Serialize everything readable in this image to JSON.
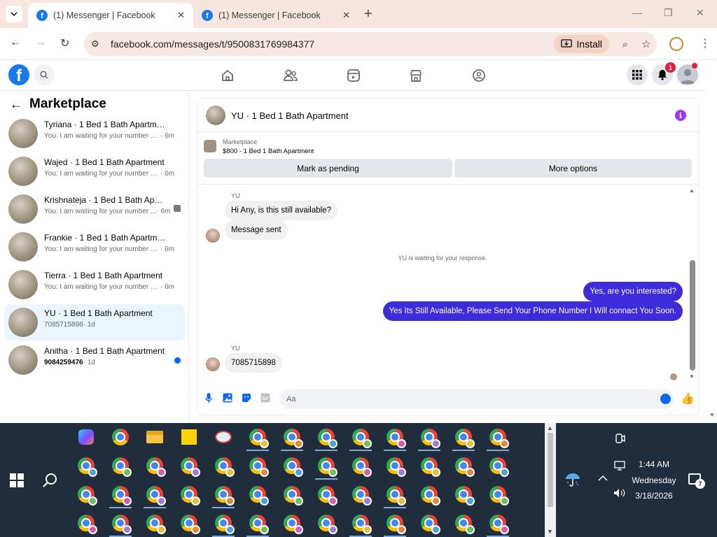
{
  "browser": {
    "tabs": [
      {
        "title": "(1) Messenger | Facebook",
        "active": true
      },
      {
        "title": "(1) Messenger | Facebook",
        "active": false
      }
    ],
    "url": "facebook.com/messages/t/9500831769984377",
    "install_label": "Install"
  },
  "facebook": {
    "notifications_count": "1"
  },
  "sidebar": {
    "title": "Marketplace",
    "conversations": [
      {
        "name": "Tyriana · 1 Bed 1 Bath Apartment",
        "preview": "You: I am waiting for your number se...",
        "time": "· 6m",
        "selected": false,
        "unread": false
      },
      {
        "name": "Wajed · 1 Bed 1 Bath Apartment",
        "preview": "You: I am waiting for your number se...",
        "time": "· 6m",
        "selected": false,
        "unread": false
      },
      {
        "name": "Krishnateja · 1 Bed 1 Bath Apart...",
        "preview": "You: I am waiting for your number ...",
        "time": "· 6m",
        "selected": false,
        "unread": false
      },
      {
        "name": "Frankie · 1 Bed 1 Bath Apartment",
        "preview": "You: I am waiting for your number se...",
        "time": "· 6m",
        "selected": false,
        "unread": false
      },
      {
        "name": "Tierra · 1 Bed 1 Bath Apartment",
        "preview": "You: I am waiting for your number se...",
        "time": "· 6m",
        "selected": false,
        "unread": false
      },
      {
        "name": "YU · 1 Bed 1 Bath Apartment",
        "preview": "7085715898",
        "time": "· 1d",
        "selected": true,
        "unread": false
      },
      {
        "name": "Anitha · 1 Bed 1 Bath Apartment",
        "preview": "9084259476",
        "time": "· 1d",
        "selected": false,
        "unread": true
      }
    ]
  },
  "chat": {
    "title": "YU · 1 Bed 1 Bath Apartment",
    "marketplace_label": "Marketplace",
    "listing": "$800 - 1 Bed 1 Bath Apartment",
    "mark_pending_label": "Mark as pending",
    "more_options_label": "More options",
    "messages": {
      "sender1": "YU",
      "in1": "Hi Any, is this still available?",
      "in2": "Message sent",
      "system": "YU is waiting for your response.",
      "out1": "Yes, are you interested?",
      "out2": "Yes Its Still Available, Please Send Your Phone Number I Will connact You Soon.",
      "sender2": "YU",
      "in3": "7085715898"
    },
    "composer_placeholder": "Aa"
  },
  "taskbar": {
    "time": "1:44 AM",
    "day": "Wednesday",
    "date": "3/18/2026",
    "notification_count": "7"
  }
}
